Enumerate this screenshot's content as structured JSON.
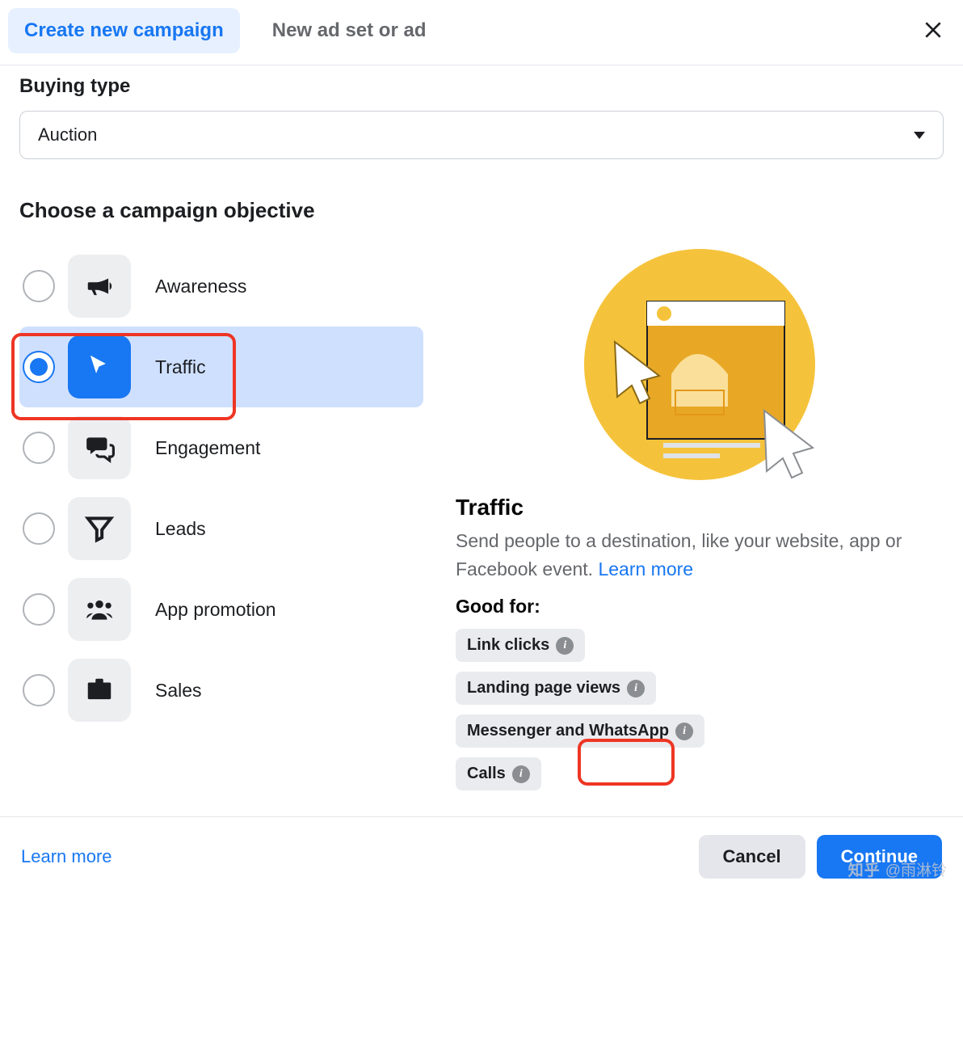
{
  "header": {
    "tab_create": "Create new campaign",
    "tab_new_adset": "New ad set or ad"
  },
  "buying_type": {
    "label": "Buying type",
    "value": "Auction"
  },
  "objective_heading": "Choose a campaign objective",
  "objectives": [
    {
      "label": "Awareness"
    },
    {
      "label": "Traffic"
    },
    {
      "label": "Engagement"
    },
    {
      "label": "Leads"
    },
    {
      "label": "App promotion"
    },
    {
      "label": "Sales"
    }
  ],
  "detail": {
    "title": "Traffic",
    "description": "Send people to a destination, like your website, app or Facebook event. ",
    "learn_more": "Learn more",
    "good_for_label": "Good for:",
    "chips": [
      "Link clicks",
      "Landing page views",
      "Messenger and WhatsApp",
      "Calls"
    ]
  },
  "footer": {
    "learn_more": "Learn more",
    "cancel": "Cancel",
    "continue": "Continue"
  },
  "watermark": {
    "brand": "知乎",
    "user": "@雨淋铃"
  }
}
